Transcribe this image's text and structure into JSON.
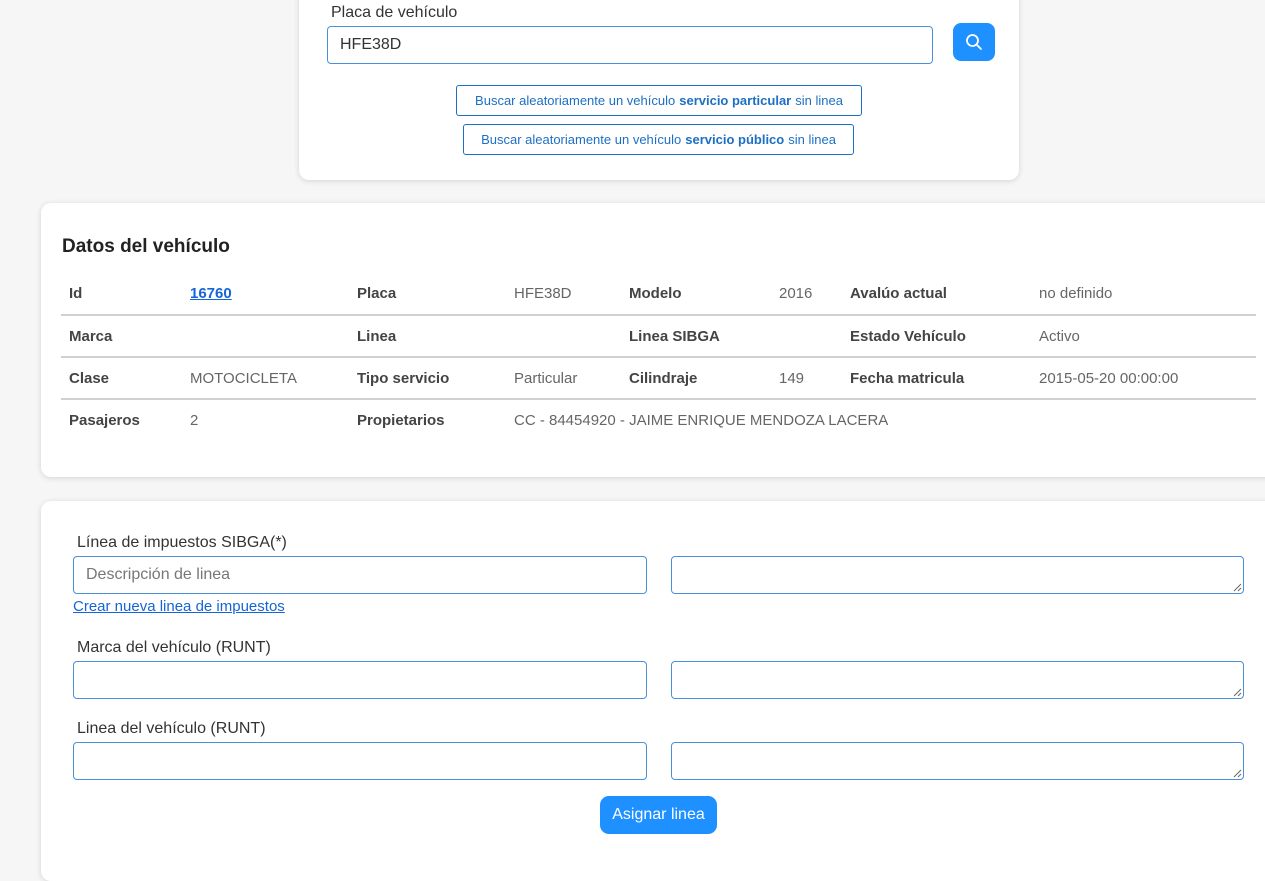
{
  "search": {
    "label": "Placa de vehículo",
    "plate_value": "HFE38D",
    "search_icon": "search-icon",
    "random_particular": {
      "pre": "Buscar aleatoriamente un vehículo",
      "bold": "servicio particular",
      "post": "sin linea"
    },
    "random_publico": {
      "pre": "Buscar aleatoriamente un vehículo",
      "bold": "servicio público",
      "post": "sin linea"
    }
  },
  "vehicle": {
    "title": "Datos del vehículo",
    "rows": [
      [
        {
          "k": "Id",
          "v": "16760"
        },
        {
          "k": "Placa",
          "v": "HFE38D"
        },
        {
          "k": "Modelo",
          "v": "2016"
        },
        {
          "k": "Avalúo actual",
          "v": "no definido"
        }
      ],
      [
        {
          "k": "Marca",
          "v": ""
        },
        {
          "k": "Linea",
          "v": ""
        },
        {
          "k": "Linea SIBGA",
          "v": ""
        },
        {
          "k": "Estado Vehículo",
          "v": "Activo"
        }
      ],
      [
        {
          "k": "Clase",
          "v": "MOTOCICLETA"
        },
        {
          "k": "Tipo servicio",
          "v": "Particular"
        },
        {
          "k": "Cilindraje",
          "v": "149"
        },
        {
          "k": "Fecha matricula",
          "v": "2015-05-20 00:00:00"
        }
      ],
      [
        {
          "k": "Pasajeros",
          "v": "2"
        },
        {
          "k": "Propietarios",
          "v": "CC - 84454920 - JAIME ENRIQUE MENDOZA LACERA"
        }
      ]
    ]
  },
  "assign": {
    "tax_line_label": "Línea de impuestos SIBGA(*)",
    "tax_line_placeholder": "Descripción de linea",
    "create_link": "Crear nueva linea de impuestos",
    "brand_label": "Marca del vehículo (RUNT)",
    "line_label": "Linea del vehículo (RUNT)",
    "assign_button": "Asignar linea"
  },
  "colors": {
    "accent": "#1e90ff",
    "link": "#1565d8",
    "input_border": "#4a90d9"
  }
}
